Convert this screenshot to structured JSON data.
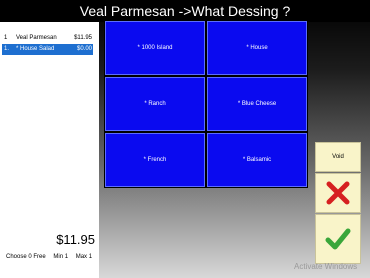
{
  "header": {
    "title": "Veal Parmesan ->What Dessing ?"
  },
  "order": {
    "items": [
      {
        "qty": "1",
        "name": "Veal Parmesan",
        "price": "$11.95"
      },
      {
        "qty": "1.",
        "name": "* House Salad",
        "price": "$0.00"
      }
    ],
    "total": "$11.95",
    "choose": {
      "free": "Choose 0 Free",
      "min": "Min 1",
      "max": "Max 1"
    }
  },
  "dressings": [
    "* 1000 Island",
    "* House",
    "* Ranch",
    "* Blue Cheese",
    "* French",
    "* Balsamic"
  ],
  "side": {
    "void_label": "Void"
  },
  "watermark": "Activate Windows",
  "colors": {
    "button_blue": "#0a0af0",
    "selected_row": "#1e6fd0",
    "side_button_bg": "#f9f4c9",
    "cancel_red": "#d62020",
    "ok_green": "#3aa63a"
  }
}
